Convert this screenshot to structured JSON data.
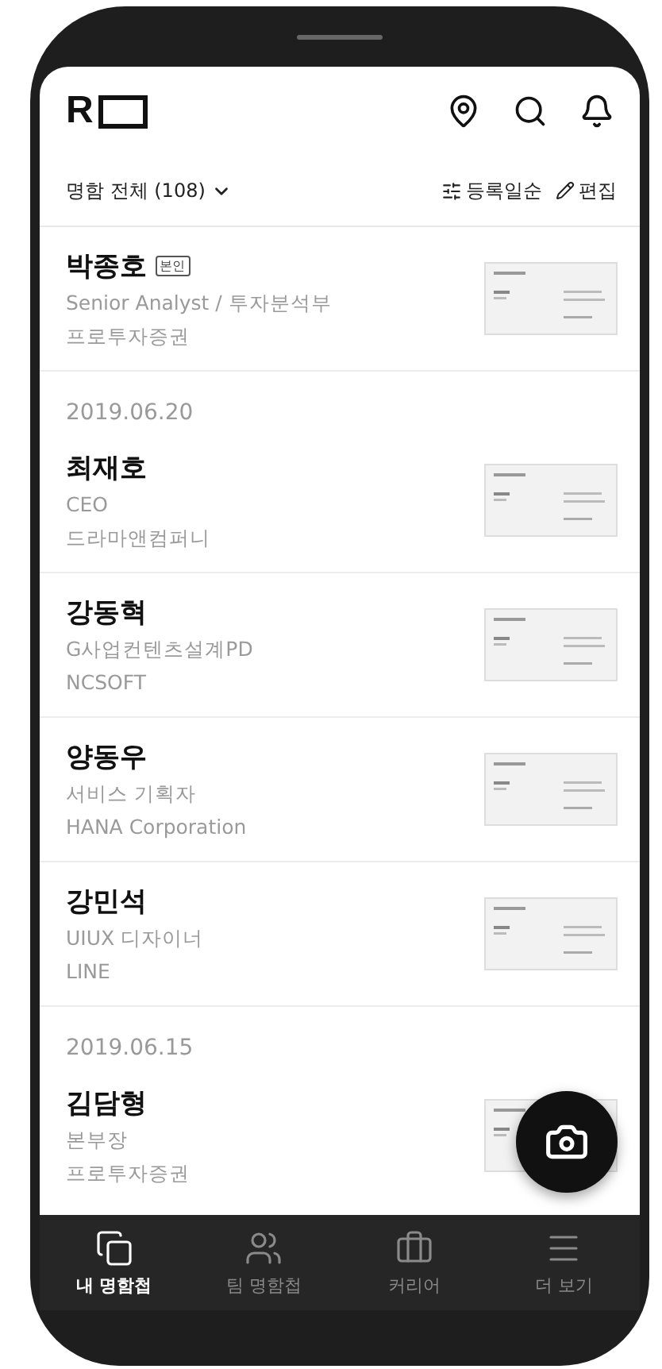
{
  "app_bar": {
    "logo": "R"
  },
  "filter_bar": {
    "label": "명함 전체 (108)",
    "sort": "등록일순",
    "edit": "편집"
  },
  "sections": [
    {
      "contacts": [
        {
          "name": "박종호",
          "badge": "본인",
          "title": "Senior Analyst / 투자분석부",
          "company": "프로투자증권"
        }
      ]
    },
    {
      "date": "2019.06.20",
      "contacts": [
        {
          "name": "최재호",
          "title": "CEO",
          "company": "드라마앤컴퍼니"
        },
        {
          "name": "강동혁",
          "title": "G사업컨텐츠설계PD",
          "company": "NCSOFT"
        },
        {
          "name": "양동우",
          "title": "서비스 기획자",
          "company": "HANA Corporation"
        },
        {
          "name": "강민석",
          "title": "UIUX 디자이너",
          "company": "LINE"
        }
      ]
    },
    {
      "date": "2019.06.15",
      "contacts": [
        {
          "name": "김담형",
          "title": "본부장",
          "company": "프로투자증권"
        }
      ]
    }
  ],
  "bottom_nav": [
    {
      "label": "내 명함첩",
      "kind": "cards",
      "selected": true
    },
    {
      "label": "팀 명함첩",
      "kind": "team",
      "selected": false
    },
    {
      "label": "커리어",
      "kind": "career",
      "selected": false
    },
    {
      "label": "더 보기",
      "kind": "more",
      "selected": false
    }
  ]
}
